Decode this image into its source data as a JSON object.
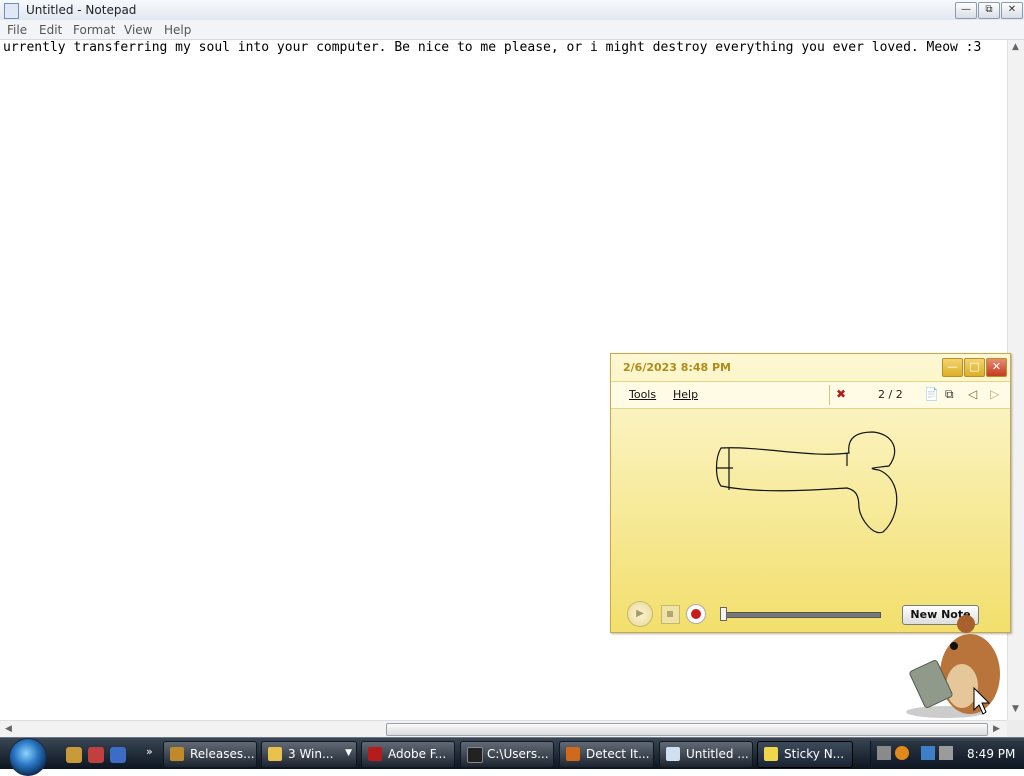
{
  "notepad": {
    "title": "Untitled - Notepad",
    "menu": [
      "File",
      "Edit",
      "Format",
      "View",
      "Help"
    ],
    "text": "urrently transferring my soul into your computer. Be nice to me please, or i might destroy everything you ever loved. Meow :3"
  },
  "sticky": {
    "timestamp": "2/6/2023 8:48 PM",
    "menu": [
      "Tools",
      "Help"
    ],
    "counter": "2 / 2",
    "new_note_label": "New Note"
  },
  "taskbar": {
    "buttons": [
      {
        "label": "Releases...",
        "icon": "globe-icon",
        "color": "#c08a2a"
      },
      {
        "label": "3 Win...",
        "icon": "folder-icon",
        "color": "#e8c24c"
      },
      {
        "label": "Adobe F...",
        "icon": "flash-icon",
        "color": "#b71c1c"
      },
      {
        "label": "C:\\Users...",
        "icon": "cmd-icon",
        "color": "#222222"
      },
      {
        "label": "Detect It...",
        "icon": "app-icon",
        "color": "#d06a1a"
      },
      {
        "label": "Untitled ...",
        "icon": "notepad-icon",
        "color": "#cfe0f2"
      },
      {
        "label": "Sticky N...",
        "icon": "sticky-notes-icon",
        "color": "#f0d64a"
      }
    ],
    "clock": "8:49 PM"
  }
}
